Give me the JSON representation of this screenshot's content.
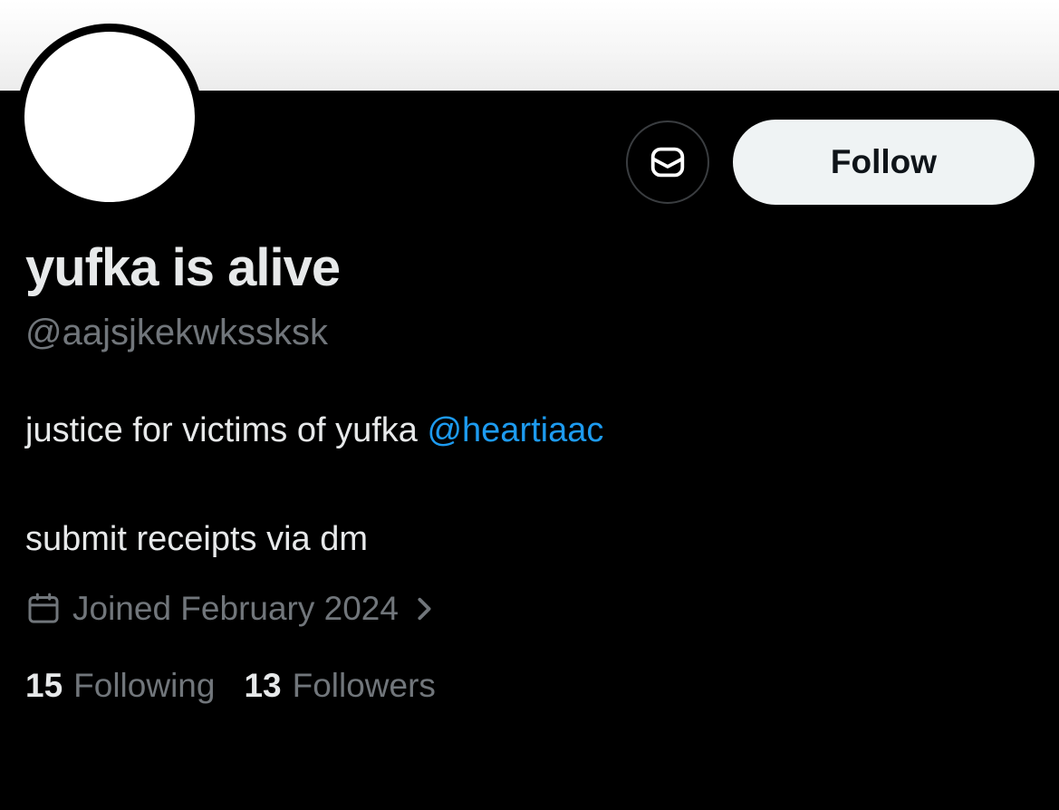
{
  "profile": {
    "display_name": "yufka is alive",
    "handle": "@aajsjkekwkssksk",
    "bio": {
      "line1_text": "justice for victims of yufka ",
      "line1_mention": "@heartiaac",
      "line2_text": "submit receipts via dm"
    },
    "joined": {
      "icon": "calendar-icon",
      "label": "Joined February 2024",
      "chevron_icon": "chevron-right-icon"
    },
    "stats": {
      "following_count": "15",
      "following_label": "Following",
      "followers_count": "13",
      "followers_label": "Followers"
    }
  },
  "actions": {
    "message_icon": "envelope-icon",
    "follow_label": "Follow"
  },
  "colors": {
    "background": "#000000",
    "primary_text": "#e7e9ea",
    "secondary_text": "#71767b",
    "link": "#1d9bf0",
    "follow_button_bg": "#eff3f4",
    "follow_button_text": "#0f1419",
    "banner": "#f4f4f4"
  }
}
